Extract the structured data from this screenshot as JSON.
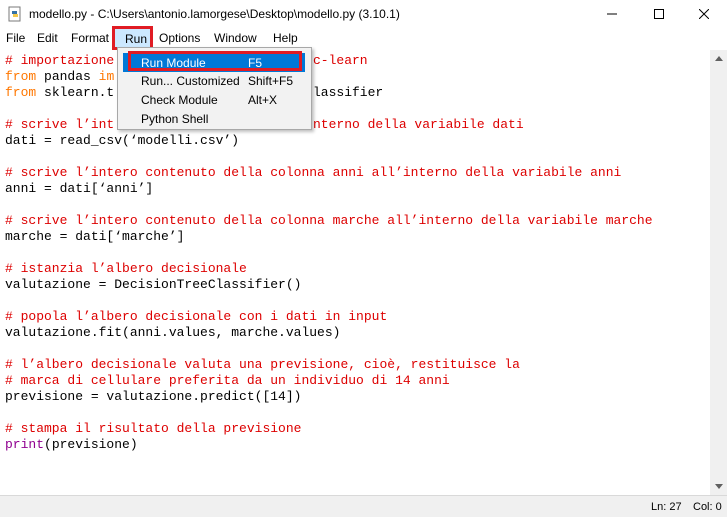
{
  "window": {
    "title": "modello.py - C:\\Users\\antonio.lamorgese\\Desktop\\modello.py (3.10.1)",
    "minimize_glyph": "—",
    "maximize_glyph": "☐",
    "close_glyph": "✕"
  },
  "menubar": {
    "items": [
      "File",
      "Edit",
      "Format",
      "Run",
      "Options",
      "Window",
      "Help"
    ]
  },
  "run_menu": {
    "items": [
      {
        "label": "Run Module",
        "shortcut": "F5"
      },
      {
        "label": "Run... Customized",
        "shortcut": "Shift+F5"
      },
      {
        "label": "Check Module",
        "shortcut": "Alt+X"
      },
      {
        "label": "Python Shell",
        "shortcut": ""
      }
    ]
  },
  "code": {
    "lines": [
      {
        "parts": [
          {
            "t": "# importazione ",
            "c": "comment"
          },
          {
            "t": "",
            "c": "comment"
          }
        ]
      },
      {
        "parts": [
          {
            "t": "from",
            "c": "keyword"
          },
          {
            "t": " pandas ",
            "c": "plain"
          },
          {
            "t": "im",
            "c": "keyword"
          }
        ]
      },
      {
        "parts": [
          {
            "t": "from",
            "c": "keyword"
          },
          {
            "t": " sklearn.t",
            "c": "plain"
          }
        ]
      },
      {
        "parts": []
      },
      {
        "parts": [
          {
            "t": "# scrive l’int",
            "c": "comment"
          }
        ]
      },
      {
        "parts": [
          {
            "t": "dati = read_csv(‘modelli.csv’)",
            "c": "plain"
          }
        ]
      },
      {
        "parts": []
      },
      {
        "parts": [
          {
            "t": "# scrive l’intero contenuto della colonna anni all’interno della variabile anni",
            "c": "comment"
          }
        ]
      },
      {
        "parts": [
          {
            "t": "anni = dati[‘anni’]",
            "c": "plain"
          }
        ]
      },
      {
        "parts": []
      },
      {
        "parts": [
          {
            "t": "# scrive l’intero contenuto della colonna marche all’interno della variabile marche",
            "c": "comment"
          }
        ]
      },
      {
        "parts": [
          {
            "t": "marche = dati[‘marche’]",
            "c": "plain"
          }
        ]
      },
      {
        "parts": []
      },
      {
        "parts": [
          {
            "t": "# istanzia l’albero decisionale",
            "c": "comment"
          }
        ]
      },
      {
        "parts": [
          {
            "t": "valutazione = DecisionTreeClassifier()",
            "c": "plain"
          }
        ]
      },
      {
        "parts": []
      },
      {
        "parts": [
          {
            "t": "# popola l’albero decisionale con i dati in input",
            "c": "comment"
          }
        ]
      },
      {
        "parts": [
          {
            "t": "valutazione.fit(anni.values, marche.values)",
            "c": "plain"
          }
        ]
      },
      {
        "parts": []
      },
      {
        "parts": [
          {
            "t": "# l’albero decisionale valuta una previsione, cioè, restituisce la",
            "c": "comment"
          }
        ]
      },
      {
        "parts": [
          {
            "t": "# marca di cellulare preferita da un individuo di 14 anni",
            "c": "comment"
          }
        ]
      },
      {
        "parts": [
          {
            "t": "previsione = valutazione.predict([14])",
            "c": "plain"
          }
        ]
      },
      {
        "parts": []
      },
      {
        "parts": [
          {
            "t": "# stampa il risultato della previsione",
            "c": "comment"
          }
        ]
      },
      {
        "parts": [
          {
            "t": "print",
            "c": "builtin"
          },
          {
            "t": "(previsione)",
            "c": "plain"
          }
        ]
      }
    ],
    "hidden_tail": {
      "line1": "c-learn",
      "line3": "lassifier",
      "line5": "nterno della variabile dati"
    }
  },
  "statusbar": {
    "line": "Ln: 27",
    "col": "Col: 0"
  },
  "colors": {
    "comment": "#dd0000",
    "keyword": "#ff7700",
    "builtin": "#900090",
    "menu_highlight": "#0078d7",
    "annotation_red": "#e01c24"
  }
}
